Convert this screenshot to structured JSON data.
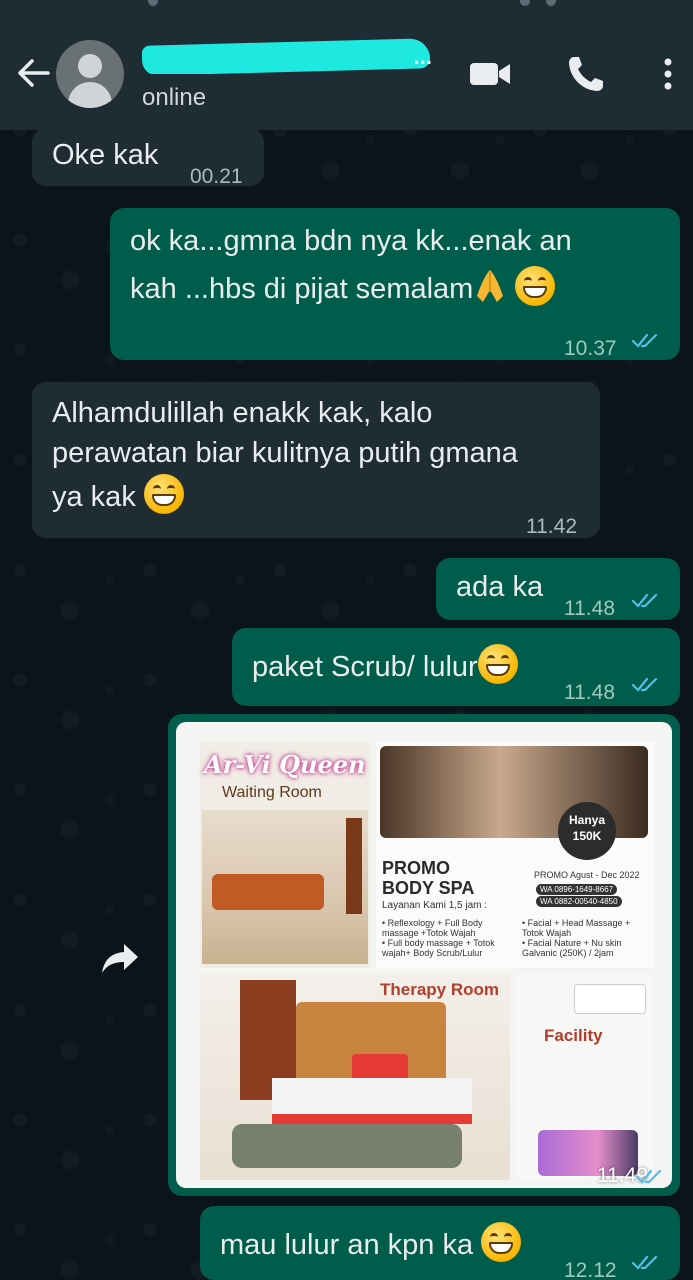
{
  "header": {
    "contact_name_visible": "...",
    "status": "online"
  },
  "messages": [
    {
      "direction": "in",
      "text": "Oke kak",
      "time": "00.21"
    },
    {
      "direction": "out",
      "lines": [
        "ok ka...gmna bdn nya kk...enak an",
        "kah ...hbs di pijat semalam"
      ],
      "time": "10.37",
      "read": true
    },
    {
      "direction": "in",
      "lines": [
        "Alhamdulillah enakk kak, kalo",
        "perawatan biar kulitnya putih gmana",
        "ya kak"
      ],
      "time": "11.42"
    },
    {
      "direction": "out",
      "text": "ada ka",
      "time": "11.48",
      "read": true
    },
    {
      "direction": "out",
      "text": "paket Scrub/ lulur",
      "time": "11.48",
      "read": true
    },
    {
      "direction": "out",
      "type": "image",
      "time": "11.49",
      "read": true
    },
    {
      "direction": "out",
      "text": "mau lulur an kpn ka",
      "time": "12.12",
      "read": true
    }
  ],
  "promo_image": {
    "brand": "Ar-Vi Queen",
    "waiting_room": "Waiting Room",
    "price_line1": "Hanya",
    "price_line2": "150K",
    "promo_title_1": "PROMO",
    "promo_title_2": "BODY SPA",
    "layanan": "Layanan Kami 1,5 jam :",
    "promo_period": "PROMO Agust - Dec 2022",
    "wa1": "WA 0896-1649-8667",
    "wa2": "WA 0882-00540-4850",
    "services_left": [
      "• Reflexology + Full Body",
      "  massage +Totok Wajah",
      "• Full body massage + Totok",
      "  wajah+ Body Scrub/Lulur"
    ],
    "services_right": [
      "• Facial + Head Massage +",
      "  Totok Wajah",
      "• Facial Nature + Nu skin",
      "  Galvanic (250K) / 2jam"
    ],
    "therapy_room": "Therapy Room",
    "facility": "Facility"
  },
  "colors": {
    "header_bg": "#1f2c34",
    "incoming_bubble": "#1f2c34",
    "outgoing_bubble": "#005c4b",
    "read_tick": "#53bdeb"
  }
}
